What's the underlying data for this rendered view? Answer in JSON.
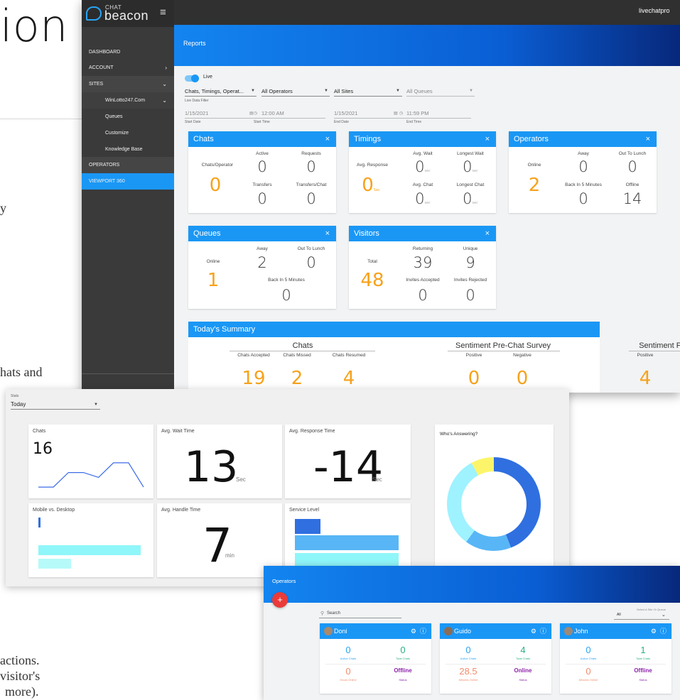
{
  "background": {
    "title_fragment": "ion",
    "text_lines": [
      "y",
      "hats and",
      "actions.",
      "visitor's",
      "more)."
    ]
  },
  "app": {
    "logo_top": "CHAT",
    "logo_main": "beacon",
    "user": "livechatpro"
  },
  "sidebar": {
    "items": [
      {
        "label": "DASHBOARD"
      },
      {
        "label": "ACCOUNT",
        "chevron": "›"
      },
      {
        "label": "SITES",
        "chevron": "⌄"
      },
      {
        "label": "WinLotto247.Com",
        "chevron": "⌄"
      },
      {
        "label": "Queues"
      },
      {
        "label": "Customize"
      },
      {
        "label": "Knowledge Base"
      },
      {
        "label": "OPERATORS"
      },
      {
        "label": "VIEWPORT 360"
      }
    ]
  },
  "reports": {
    "title": "Reports",
    "live_label": "Live",
    "filters": {
      "data": "Chats, Timings, Operat...",
      "data_sub": "Live Data Filter",
      "operators": "All Operators",
      "sites": "All Sites",
      "queues": "All Queues",
      "start_date": "1/15/2021",
      "start_date_sub": "Start Date",
      "start_time": "12:00 AM",
      "start_time_sub": "Start Time",
      "end_date": "1/15/2021",
      "end_date_sub": "End Date",
      "end_time": "11:59 PM",
      "end_time_sub": "End Time"
    },
    "chats": {
      "title": "Chats",
      "per_operator_label": "Chats/Operator",
      "per_operator": "0",
      "active_label": "Active",
      "active": "0",
      "requests_label": "Requests",
      "requests": "0",
      "transfers_label": "Transfers",
      "transfers": "0",
      "transfers_chat_label": "Transfers/Chat",
      "transfers_chat": "0"
    },
    "timings": {
      "title": "Timings",
      "avg_response_label": "Avg. Response",
      "avg_response": "0",
      "avg_response_unit": "Sec",
      "avg_wait_label": "Avg. Wait",
      "avg_wait": "0",
      "avg_wait_unit": "sec",
      "longest_wait_label": "Longest Wait",
      "longest_wait": "0",
      "longest_wait_unit": "sec",
      "avg_chat_label": "Avg. Chat",
      "avg_chat": "0",
      "avg_chat_unit": "sec",
      "longest_chat_label": "Longest Chat",
      "longest_chat": "0",
      "longest_chat_unit": "sec"
    },
    "operators": {
      "title": "Operators",
      "online_label": "Online",
      "online": "2",
      "away_label": "Away",
      "away": "0",
      "lunch_label": "Out To Lunch",
      "lunch": "0",
      "back5_label": "Back In 5 Minutes",
      "back5": "0",
      "offline_label": "Offline",
      "offline": "14"
    },
    "queues": {
      "title": "Queues",
      "online_label": "Online",
      "online": "1",
      "away_label": "Away",
      "away": "2",
      "lunch_label": "Out To Lunch",
      "lunch": "0",
      "back5_label": "Back In 5 Minutes",
      "back5": "0"
    },
    "visitors": {
      "title": "Visitors",
      "total_label": "Total",
      "total": "48",
      "returning_label": "Returning",
      "returning": "39",
      "unique_label": "Unique",
      "unique": "9",
      "accepted_label": "Invites Accepted",
      "accepted": "0",
      "rejected_label": "Invites Rejected",
      "rejected": "0"
    },
    "summary": {
      "title": "Today's Summary",
      "chats_title": "Chats",
      "accepted_label": "Chats Accepted",
      "accepted": "19",
      "missed_label": "Chats Missed",
      "missed": "2",
      "resumed_label": "Chats Resumed",
      "resumed": "4",
      "pre_title": "Sentiment Pre-Chat Survey",
      "pre_pos_label": "Positive",
      "pre_pos": "0",
      "pre_neg_label": "Negative",
      "pre_neg": "0",
      "post_title": "Sentiment Post C",
      "post_pos_label": "Positive",
      "post_pos": "4"
    },
    "close_icon": "×"
  },
  "stats": {
    "label": "Stats",
    "period": "Today",
    "chats_title": "Chats",
    "chats_value": "16",
    "wait_title": "Avg. Wait Time",
    "wait_value": "13",
    "wait_unit": "Sec",
    "response_title": "Avg. Response Time",
    "response_value": "-14",
    "response_unit": "Sec",
    "whos_answering_title": "Who's Answering?",
    "mobile_title": "Mobile vs. Desktop",
    "handle_title": "Avg. Handle Time",
    "handle_value": "7",
    "handle_unit": "min",
    "service_title": "Service Level"
  },
  "chart_data": [
    {
      "type": "line",
      "title": "Chats",
      "x": [
        0,
        1,
        2,
        3,
        4,
        5,
        6,
        7
      ],
      "values": [
        1,
        1,
        4,
        4,
        3,
        6,
        6,
        1
      ]
    },
    {
      "type": "pie",
      "title": "Who's Answering?",
      "labels": [
        "",
        "",
        "",
        ""
      ],
      "values": [
        44,
        16,
        32,
        8
      ],
      "colors": [
        "#2f6fe0",
        "#58b6f6",
        "#9ff2ff",
        "#fcf56a"
      ]
    },
    {
      "type": "bar",
      "title": "Mobile vs. Desktop",
      "values": [
        0.02,
        0.97,
        0.31
      ],
      "colors": [
        "#2f6fe0",
        "#8ff6f9",
        "#b7fafa"
      ]
    },
    {
      "type": "bar",
      "title": "Service Level",
      "values": [
        0.24,
        0.97,
        0.97
      ],
      "colors": [
        "#2f6fe0",
        "#58b6f6",
        "#8ff6f9"
      ]
    }
  ],
  "ops_page": {
    "title": "Operators",
    "add_symbol": "+",
    "search_placeholder": "Search",
    "filter_label": "Select A Site Or Queue",
    "filter_value": "All",
    "cards": [
      {
        "name": "Doni",
        "active_chats": "0",
        "active_label": "Active Chats",
        "total_chats": "0",
        "total_label": "Total Chats",
        "time": "0",
        "time_label": "Hours Online",
        "status": "Offline",
        "status_label": "Status",
        "status_color": "#8e24aa"
      },
      {
        "name": "Guido",
        "active_chats": "0",
        "active_label": "Active Chats",
        "total_chats": "4",
        "total_label": "Total Chats",
        "time": "28.5",
        "time_label": "Minutes Online",
        "status": "Online",
        "status_label": "Status",
        "status_color": "#8e24aa"
      },
      {
        "name": "John",
        "active_chats": "0",
        "active_label": "Active Chats",
        "total_chats": "1",
        "total_label": "Total Chats",
        "time": "0",
        "time_label": "Minutes Online",
        "status": "Offline",
        "status_label": "Status",
        "status_color": "#8e24aa"
      }
    ]
  }
}
